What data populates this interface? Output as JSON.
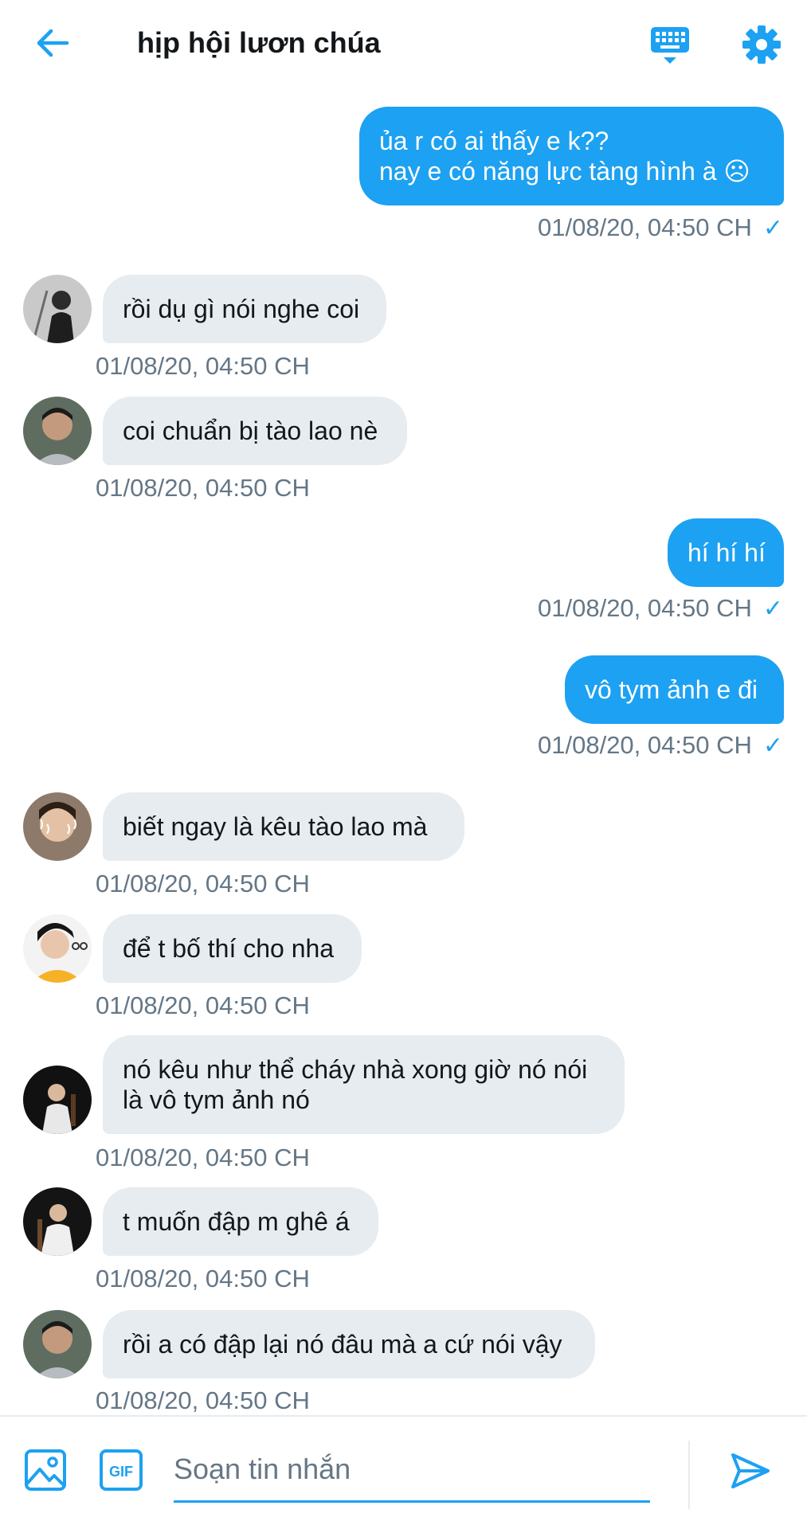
{
  "header": {
    "title": "hịp hội lươn chúa",
    "back_icon": "arrow-left-icon",
    "keyboard_icon": "keyboard-icon",
    "settings_icon": "gear-icon"
  },
  "colors": {
    "accent": "#1da1f2",
    "incoming_bubble": "#e6ecf0",
    "timestamp": "#657786"
  },
  "messages": [
    {
      "dir": "out",
      "text": "ủa r có ai thấy e k??\nnay e có năng lực tàng hình à ☹",
      "time": "01/08/20, 04:50 CH"
    },
    {
      "dir": "in",
      "text": "rồi dụ gì nói nghe coi",
      "time": "01/08/20, 04:50 CH"
    },
    {
      "dir": "in",
      "text": "coi chuẩn bị tào lao nè",
      "time": "01/08/20, 04:50 CH"
    },
    {
      "dir": "out",
      "text": "hí hí hí",
      "time": "01/08/20, 04:50 CH"
    },
    {
      "dir": "out",
      "text": "vô tym ảnh e đi",
      "time": "01/08/20, 04:50 CH"
    },
    {
      "dir": "in",
      "text": "biết ngay là kêu tào lao mà",
      "time": "01/08/20, 04:50 CH"
    },
    {
      "dir": "in",
      "text": "để t bố thí cho nha",
      "time": "01/08/20, 04:50 CH"
    },
    {
      "dir": "in",
      "text": "nó kêu như thể cháy nhà xong giờ nó nói\nlà vô tym ảnh nó",
      "time": "01/08/20, 04:50 CH"
    },
    {
      "dir": "in",
      "text": "t muốn đập m ghê á",
      "time": "01/08/20, 04:50 CH"
    },
    {
      "dir": "in",
      "text": "rồi a có đập lại nó đâu mà a cứ nói vậy",
      "time": "01/08/20, 04:50 CH"
    }
  ],
  "composer": {
    "placeholder": "Soạn tin nhắn",
    "image_icon": "image-icon",
    "gif_icon": "gif-icon",
    "gif_label": "GIF",
    "send_icon": "send-icon"
  }
}
